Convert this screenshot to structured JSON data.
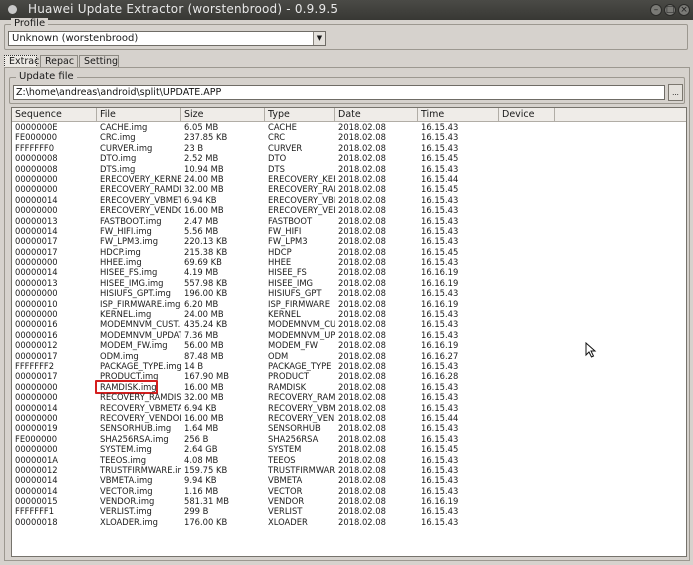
{
  "window": {
    "title": "Huawei Update Extractor (worstenbrood) - 0.9.9.5"
  },
  "profile": {
    "label": "Profile",
    "selected": "Unknown (worstenbrood)"
  },
  "tabs": [
    {
      "label": "Extrac"
    },
    {
      "label": "Repac"
    },
    {
      "label": "Setting"
    }
  ],
  "update_file": {
    "label": "Update file",
    "path": "Z:\\home\\andreas\\android\\split\\UPDATE.APP",
    "browse_label": "..."
  },
  "columns": [
    "Sequence",
    "File",
    "Size",
    "Type",
    "Date",
    "Time",
    "Device"
  ],
  "rows": [
    [
      "0000000E",
      "CACHE.img",
      "6.05 MB",
      "CACHE",
      "2018.02.08",
      "16.15.43",
      ""
    ],
    [
      "FE000000",
      "CRC.img",
      "237.85 KB",
      "CRC",
      "2018.02.08",
      "16.15.43",
      ""
    ],
    [
      "FFFFFFF0",
      "CURVER.img",
      "23 B",
      "CURVER",
      "2018.02.08",
      "16.15.43",
      ""
    ],
    [
      "00000008",
      "DTO.img",
      "2.52 MB",
      "DTO",
      "2018.02.08",
      "16.15.45",
      ""
    ],
    [
      "00000008",
      "DTS.img",
      "10.94 MB",
      "DTS",
      "2018.02.08",
      "16.15.43",
      ""
    ],
    [
      "00000000",
      "ERECOVERY_KERNE.i",
      "24.00 MB",
      "ERECOVERY_KER",
      "2018.02.08",
      "16.15.44",
      ""
    ],
    [
      "00000000",
      "ERECOVERY_RAMDI.i",
      "32.00 MB",
      "ERECOVERY_RAM",
      "2018.02.08",
      "16.15.45",
      ""
    ],
    [
      "00000014",
      "ERECOVERY_VBMET.i",
      "6.94 KB",
      "ERECOVERY_VBM",
      "2018.02.08",
      "16.15.43",
      ""
    ],
    [
      "00000000",
      "ERECOVERY_VENDO.i",
      "16.00 MB",
      "ERECOVERY_VEN",
      "2018.02.08",
      "16.15.43",
      ""
    ],
    [
      "00000013",
      "FASTBOOT.img",
      "2.47 MB",
      "FASTBOOT",
      "2018.02.08",
      "16.15.43",
      ""
    ],
    [
      "00000014",
      "FW_HIFI.img",
      "5.56 MB",
      "FW_HIFI",
      "2018.02.08",
      "16.15.43",
      ""
    ],
    [
      "00000017",
      "FW_LPM3.img",
      "220.13 KB",
      "FW_LPM3",
      "2018.02.08",
      "16.15.43",
      ""
    ],
    [
      "00000017",
      "HDCP.img",
      "215.38 KB",
      "HDCP",
      "2018.02.08",
      "16.15.45",
      ""
    ],
    [
      "00000000",
      "HHEE.img",
      "69.69 KB",
      "HHEE",
      "2018.02.08",
      "16.15.43",
      ""
    ],
    [
      "00000014",
      "HISEE_FS.img",
      "4.19 MB",
      "HISEE_FS",
      "2018.02.08",
      "16.16.19",
      ""
    ],
    [
      "00000013",
      "HISEE_IMG.img",
      "557.98 KB",
      "HISEE_IMG",
      "2018.02.08",
      "16.16.19",
      ""
    ],
    [
      "00000000",
      "HISIUFS_GPT.img",
      "196.00 KB",
      "HISIUFS_GPT",
      "2018.02.08",
      "16.15.43",
      ""
    ],
    [
      "00000010",
      "ISP_FIRMWARE.img",
      "6.20 MB",
      "ISP_FIRMWARE",
      "2018.02.08",
      "16.16.19",
      ""
    ],
    [
      "00000000",
      "KERNEL.img",
      "24.00 MB",
      "KERNEL",
      "2018.02.08",
      "16.15.43",
      ""
    ],
    [
      "00000016",
      "MODEMNVM_CUST.i",
      "435.24 KB",
      "MODEMNVM_CUS",
      "2018.02.08",
      "16.15.43",
      ""
    ],
    [
      "00000016",
      "MODEMNVM_UPDATE",
      "7.36 MB",
      "MODEMNVM_UPD",
      "2018.02.08",
      "16.15.43",
      ""
    ],
    [
      "00000012",
      "MODEM_FW.img",
      "56.00 MB",
      "MODEM_FW",
      "2018.02.08",
      "16.16.19",
      ""
    ],
    [
      "00000017",
      "ODM.img",
      "87.48 MB",
      "ODM",
      "2018.02.08",
      "16.16.27",
      ""
    ],
    [
      "FFFFFFF2",
      "PACKAGE_TYPE.img",
      "14 B",
      "PACKAGE_TYPE",
      "2018.02.08",
      "16.15.43",
      ""
    ],
    [
      "00000017",
      "PRODUCT.img",
      "167.90 MB",
      "PRODUCT",
      "2018.02.08",
      "16.16.28",
      ""
    ],
    [
      "00000000",
      "RAMDISK.img",
      "16.00 MB",
      "RAMDISK",
      "2018.02.08",
      "16.15.43",
      ""
    ],
    [
      "00000000",
      "RECOVERY_RAMDIS.i",
      "32.00 MB",
      "RECOVERY_RAM",
      "2018.02.08",
      "16.15.43",
      ""
    ],
    [
      "00000014",
      "RECOVERY_VBMETA.i",
      "6.94 KB",
      "RECOVERY_VBME",
      "2018.02.08",
      "16.15.43",
      ""
    ],
    [
      "00000000",
      "RECOVERY_VENDOR.i",
      "16.00 MB",
      "RECOVERY_VEND",
      "2018.02.08",
      "16.15.44",
      ""
    ],
    [
      "00000019",
      "SENSORHUB.img",
      "1.64 MB",
      "SENSORHUB",
      "2018.02.08",
      "16.15.43",
      ""
    ],
    [
      "FE000000",
      "SHA256RSA.img",
      "256 B",
      "SHA256RSA",
      "2018.02.08",
      "16.15.43",
      ""
    ],
    [
      "00000000",
      "SYSTEM.img",
      "2.64 GB",
      "SYSTEM",
      "2018.02.08",
      "16.15.45",
      ""
    ],
    [
      "0000001A",
      "TEEOS.img",
      "4.08 MB",
      "TEEOS",
      "2018.02.08",
      "16.15.43",
      ""
    ],
    [
      "00000012",
      "TRUSTFIRMWARE.im",
      "159.75 KB",
      "TRUSTFIRMWARE",
      "2018.02.08",
      "16.15.43",
      ""
    ],
    [
      "00000014",
      "VBMETA.img",
      "9.94 KB",
      "VBMETA",
      "2018.02.08",
      "16.15.43",
      ""
    ],
    [
      "00000014",
      "VECTOR.img",
      "1.16 MB",
      "VECTOR",
      "2018.02.08",
      "16.15.43",
      ""
    ],
    [
      "00000015",
      "VENDOR.img",
      "581.31 MB",
      "VENDOR",
      "2018.02.08",
      "16.16.19",
      ""
    ],
    [
      "FFFFFFF1",
      "VERLIST.img",
      "299 B",
      "VERLIST",
      "2018.02.08",
      "16.15.43",
      ""
    ],
    [
      "00000018",
      "XLOADER.img",
      "176.00 KB",
      "XLOADER",
      "2018.02.08",
      "16.15.43",
      ""
    ]
  ],
  "highlighted_row": 25,
  "highlight_color": "#d41f1f"
}
